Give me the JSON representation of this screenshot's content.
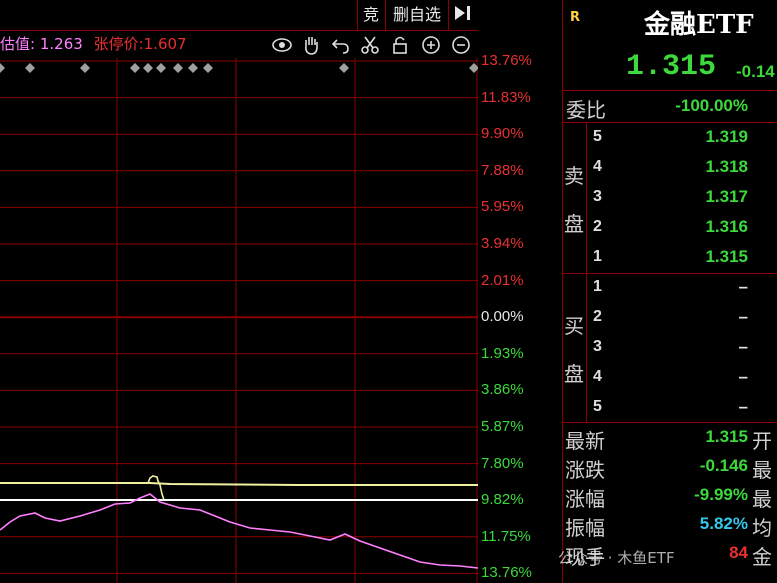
{
  "toolbar": {
    "jing": "竞",
    "del_watch": "删自选",
    "collapse_icon": "▶|"
  },
  "info": {
    "est_label": "估值:",
    "est_value": "1.263",
    "limit_label": "张停价:",
    "limit_value": "1.607"
  },
  "icons": [
    "eye-icon",
    "hand-icon",
    "undo-icon",
    "scissors-icon",
    "lock-icon",
    "zoom-in-icon",
    "zoom-out-icon"
  ],
  "pct_labels": [
    "13.76%",
    "11.83%",
    "9.90%",
    "7.88%",
    "5.95%",
    "3.94%",
    "2.01%",
    "0.00%",
    "1.93%",
    "3.86%",
    "5.87%",
    "7.80%",
    "9.82%",
    "11.75%",
    "13.76%"
  ],
  "stock": {
    "badge": "R",
    "name": "金融ETF",
    "price": "1.315",
    "change": "-0.14"
  },
  "weibi": {
    "label": "委比",
    "value": "-100.00%"
  },
  "sell": {
    "label1": "卖",
    "label2": "盘",
    "rows": [
      {
        "idx": "5",
        "price": "1.319"
      },
      {
        "idx": "4",
        "price": "1.318"
      },
      {
        "idx": "3",
        "price": "1.317"
      },
      {
        "idx": "2",
        "price": "1.316"
      },
      {
        "idx": "1",
        "price": "1.315"
      }
    ]
  },
  "buy": {
    "label1": "买",
    "label2": "盘",
    "rows": [
      {
        "idx": "1",
        "price": "–"
      },
      {
        "idx": "2",
        "price": "–"
      },
      {
        "idx": "3",
        "price": "–"
      },
      {
        "idx": "4",
        "price": "–"
      },
      {
        "idx": "5",
        "price": "–"
      }
    ]
  },
  "stats": [
    {
      "label": "最新",
      "value": "1.315",
      "side": "开",
      "color": "#3cd83c"
    },
    {
      "label": "涨跌",
      "value": "-0.146",
      "side": "最",
      "color": "#3cd83c"
    },
    {
      "label": "涨幅",
      "value": "-9.99%",
      "side": "最",
      "color": "#3cd83c"
    },
    {
      "label": "振幅",
      "value": "5.82%",
      "side": "均",
      "color": "#33c8e8"
    },
    {
      "label": "现手",
      "value": "84",
      "side": "金",
      "color": "#e83030"
    }
  ],
  "watermark": "公众号 · 木鱼ETF",
  "colors": {
    "grid": "#8a0000",
    "price_line": "#ff80ff",
    "avg_line": "#f0f0a0",
    "ref_line": "#ffffff",
    "up": "#e83030",
    "down": "#3cd83c"
  }
}
